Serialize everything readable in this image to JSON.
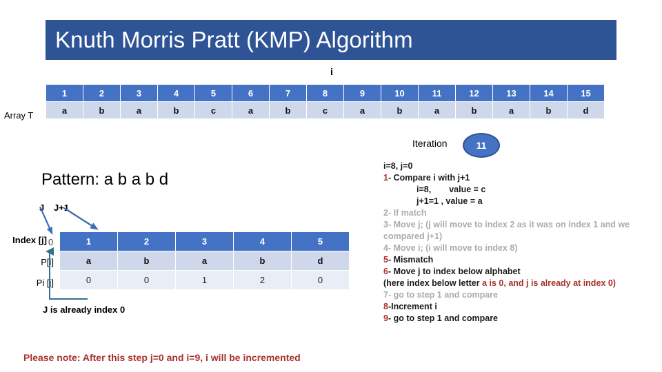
{
  "title": "Knuth Morris Pratt (KMP) Algorithm",
  "colors": {
    "banner": "#2E5496",
    "header_cell": "#4472C4",
    "value_cell": "#CFD7EA",
    "pi_cell": "#E9EDF6",
    "accent_red": "#A8312B",
    "muted_grey": "#ABABAB",
    "arrow_blue": "#4472C4",
    "elbow_teal": "#31708E"
  },
  "array_section": {
    "pointer_label": "i",
    "row_label": "Array T",
    "indices": [
      "1",
      "2",
      "3",
      "4",
      "5",
      "6",
      "7",
      "8",
      "9",
      "10",
      "11",
      "12",
      "13",
      "14",
      "15"
    ],
    "values": [
      "a",
      "b",
      "a",
      "b",
      "c",
      "a",
      "b",
      "c",
      "a",
      "b",
      "a",
      "b",
      "a",
      "b",
      "d"
    ]
  },
  "iteration": {
    "label": "Iteration",
    "value": "11"
  },
  "pattern_section": {
    "heading": "Pattern: a b a b d",
    "j_label": "J",
    "j_plus_one_label": "J+1",
    "index_row_label": "Index [j]",
    "zero_outside": "0",
    "p_row_label": "P[i]",
    "pi_row_label": "Pi [j]",
    "indices": [
      "1",
      "2",
      "3",
      "4",
      "5"
    ],
    "p_values": [
      "a",
      "b",
      "a",
      "b",
      "d"
    ],
    "pi_values": [
      "0",
      "0",
      "1",
      "2",
      "0"
    ],
    "already_index_note": "J is already index 0"
  },
  "please_note": "Please note: After this step j=0 and i=9, i will be incremented",
  "explanation": {
    "state": "i=8, j=0",
    "step1_num": "1",
    "step1_text": "- Compare i with j+1",
    "step1_sub_a": "i=8,",
    "step1_sub_a2": "value = c",
    "step1_sub_b": "j+1=1 , value = a",
    "step2": "2- If match",
    "step3": "3- Move j; (j will move to index 2 as it was on index 1 and we compared j+1)",
    "step4": "4- Move i; (i will move to index 8)",
    "step5_num": "5",
    "step5_text": "- Mismatch",
    "step6_num": "6",
    "step6_text": "- Move j to index below alphabet",
    "step6_note_black": "(here index below letter ",
    "step6_note_red": "a is 0, and j is already at index 0)",
    "step7": "7- go to step 1 and compare",
    "step8_num": "8",
    "step8_text": "-Increment i",
    "step9_num": "9",
    "step9_text": "- go to step 1 and compare"
  }
}
